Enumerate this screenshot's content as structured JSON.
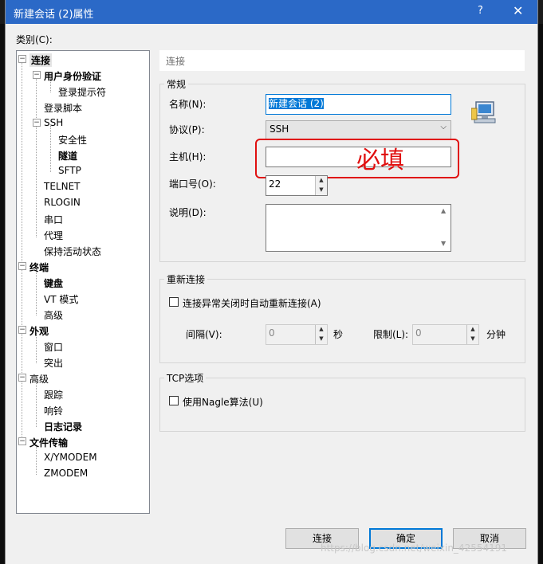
{
  "titlebar": {
    "title": "新建会话 (2)属性",
    "help": "?",
    "close": "✕"
  },
  "category_label": "类别(C):",
  "tree": {
    "items": [
      {
        "label": "连接",
        "bold": true,
        "selected": true
      },
      {
        "label": "用户身份验证",
        "bold": true
      },
      {
        "label": "登录提示符",
        "bold": false
      },
      {
        "label": "登录脚本",
        "bold": false
      },
      {
        "label": "SSH",
        "bold": false
      },
      {
        "label": "安全性",
        "bold": false
      },
      {
        "label": "隧道",
        "bold": true
      },
      {
        "label": "SFTP",
        "bold": false
      },
      {
        "label": "TELNET",
        "bold": false
      },
      {
        "label": "RLOGIN",
        "bold": false
      },
      {
        "label": "串口",
        "bold": false
      },
      {
        "label": "代理",
        "bold": false
      },
      {
        "label": "保持活动状态",
        "bold": false
      },
      {
        "label": "终端",
        "bold": true
      },
      {
        "label": "键盘",
        "bold": true
      },
      {
        "label": "VT 模式",
        "bold": false
      },
      {
        "label": "高级",
        "bold": false
      },
      {
        "label": "外观",
        "bold": true
      },
      {
        "label": "窗口",
        "bold": false
      },
      {
        "label": "突出",
        "bold": false
      },
      {
        "label": "高级",
        "bold": false
      },
      {
        "label": "跟踪",
        "bold": false
      },
      {
        "label": "响铃",
        "bold": false
      },
      {
        "label": "日志记录",
        "bold": true
      },
      {
        "label": "文件传输",
        "bold": true
      },
      {
        "label": "X/YMODEM",
        "bold": false
      },
      {
        "label": "ZMODEM",
        "bold": false
      }
    ]
  },
  "panel_head": "连接",
  "general": {
    "title": "常规",
    "name_label": "名称(N):",
    "name_value": "新建会话 (2)",
    "protocol_label": "协议(P):",
    "protocol_value": "SSH",
    "host_label": "主机(H):",
    "host_value": "",
    "port_label": "端口号(O):",
    "port_value": "22",
    "desc_label": "说明(D):",
    "desc_value": ""
  },
  "annotation": "必填",
  "reconnect": {
    "title": "重新连接",
    "checkbox_label": "连接异常关闭时自动重新连接(A)",
    "interval_label": "间隔(V):",
    "interval_value": "0",
    "interval_unit": "秒",
    "limit_label": "限制(L):",
    "limit_value": "0",
    "limit_unit": "分钟"
  },
  "tcp": {
    "title": "TCP选项",
    "checkbox_label": "使用Nagle算法(U)"
  },
  "buttons": {
    "connect": "连接",
    "ok": "确定",
    "cancel": "取消"
  },
  "watermark": "https://blog.csdn.net/weixin_42554191",
  "colors": {
    "titlebar": "#2b69c7",
    "accent": "#0078d7",
    "annotation": "#e01010"
  }
}
